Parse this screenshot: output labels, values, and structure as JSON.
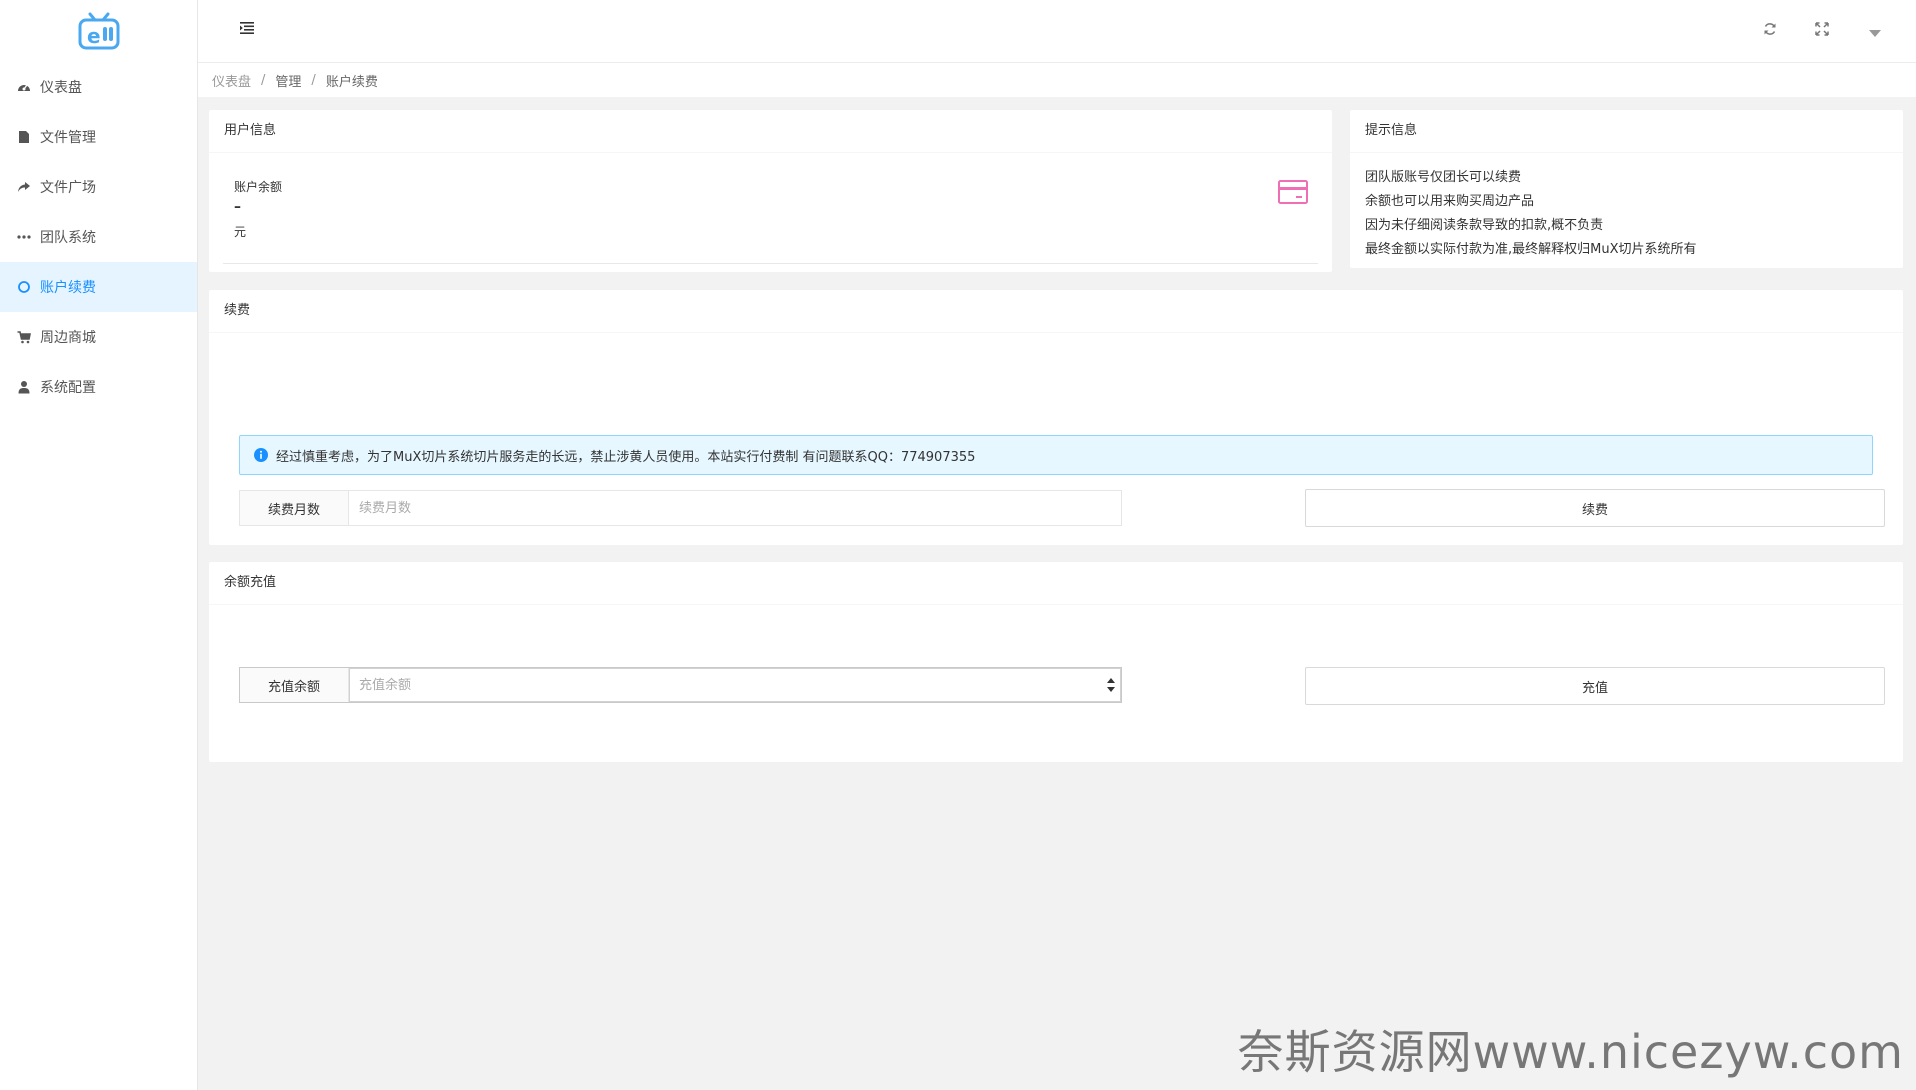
{
  "sidebar": {
    "items": [
      {
        "label": "仪表盘",
        "icon": "dashboard-icon"
      },
      {
        "label": "文件管理",
        "icon": "file-icon"
      },
      {
        "label": "文件广场",
        "icon": "share-icon"
      },
      {
        "label": "团队系统",
        "icon": "more-icon"
      },
      {
        "label": "账户续费",
        "icon": "circle-icon",
        "active": true
      },
      {
        "label": "周边商城",
        "icon": "cart-icon"
      },
      {
        "label": "系统配置",
        "icon": "user-icon"
      }
    ]
  },
  "breadcrumb": {
    "items": [
      "仪表盘",
      "管理",
      "账户续费"
    ],
    "separator": "/"
  },
  "user_info": {
    "title": "用户信息",
    "balance_label": "账户余额",
    "balance_value": "–",
    "balance_unit": "元"
  },
  "tips": {
    "title": "提示信息",
    "lines": [
      "团队版账号仅团长可以续费",
      "余额也可以用来购买周边产品",
      "因为未仔细阅读条款导致的扣款,概不负责",
      "最终金额以实际付款为准,最终解释权归MuX切片系统所有"
    ]
  },
  "renew": {
    "title": "续费",
    "notice": "经过慎重考虑，为了MuX切片系统切片服务走的长远，禁止涉黄人员使用。本站实行付费制 有问题联系QQ：774907355",
    "input_label": "续费月数",
    "input_placeholder": "续费月数",
    "input_value": "",
    "button_label": "续费"
  },
  "recharge": {
    "title": "余额充值",
    "input_label": "充值余额",
    "input_placeholder": "充值余额",
    "input_value": "",
    "button_label": "充值"
  },
  "watermark": "奈斯资源网www.nicezyw.com",
  "colors": {
    "accent": "#1890ff",
    "active_bg": "#e6f4ff",
    "alert_bg": "#e6f7ff",
    "alert_border": "#91d5ff",
    "card_icon": "#f06fb4",
    "logo": "#4aa8f0"
  }
}
